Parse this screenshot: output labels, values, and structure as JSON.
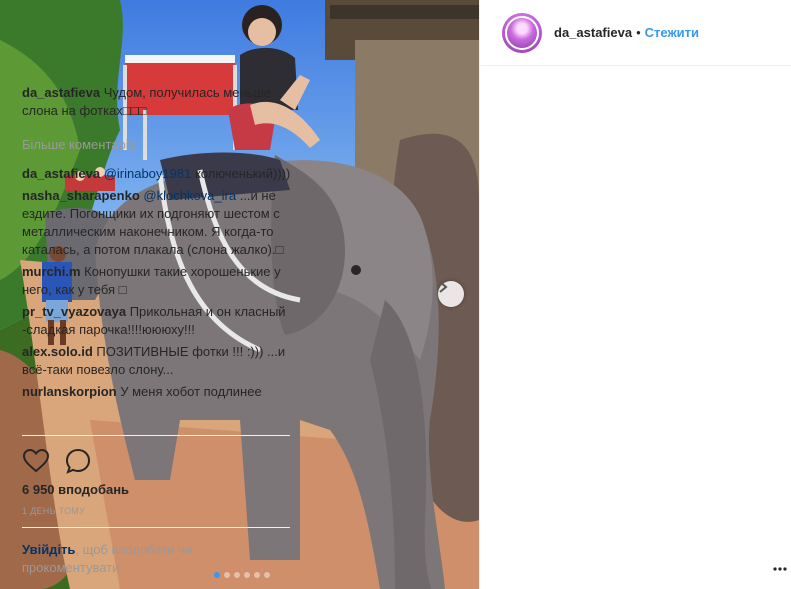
{
  "post": {
    "username": "da_astafieva",
    "separator": "•",
    "follow_label": "Стежити",
    "caption": "Чудом, получилась меньше слона на фотках□□□",
    "more_comments_label": "Більше коментарів",
    "likes": "6 950 вподобань",
    "time_ago": "1 ДЕНЬ ТОМУ",
    "login_link": "Увійдіть",
    "login_text": ", щоб вподобати чи прокоментувати.",
    "carousel": {
      "total": 6,
      "active_index": 0
    }
  },
  "comments": [
    {
      "user": "da_astafieva",
      "mention": "@irinaboy1981",
      "text": " колюченький))))"
    },
    {
      "user": "nasha_sharapenko",
      "mention": "@klochkova_ira",
      "text": " ...и не ездите. Погонщики их подгоняют шестом с металлическим наконечником. Я когда-то каталась, а потом плакала (слона жалко).□"
    },
    {
      "user": "murchi.m",
      "mention": "",
      "text": " Конопушки такие хорошенькие у него, как у тебя □"
    },
    {
      "user": "pr_tv_vyazovaya",
      "mention": "",
      "text": " Прикольная и он класный -сладкая парочка!!!!юююху!!!"
    },
    {
      "user": "alex.solo.id",
      "mention": "",
      "text": " ПОЗИТИВНЫЕ фотки !!! :))) ...и всё-таки повезло слону..."
    },
    {
      "user": "nurlanskorpion",
      "mention": "",
      "text": " У меня хобот подлинее"
    }
  ],
  "colors": {
    "link_blue": "#3897f0",
    "mention_blue": "#003569",
    "muted": "#999999",
    "border": "#efefef"
  },
  "icons": [
    "chevron-right-icon",
    "heart-icon",
    "comment-icon",
    "more-options-icon"
  ]
}
